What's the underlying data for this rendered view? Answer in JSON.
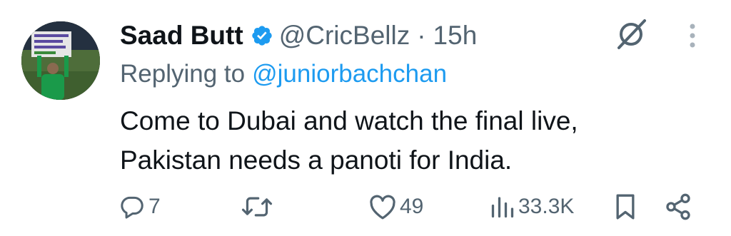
{
  "tweet": {
    "author_name": "Saad Butt",
    "handle": "@CricBellz",
    "separator": "·",
    "time": "15h",
    "replying_prefix": "Replying to",
    "replying_to": "@juniorbachchan",
    "text_line1": "Come to Dubai and watch the final live,",
    "text_line2": "Pakistan needs a panoti for India."
  },
  "metrics": {
    "replies": "7",
    "retweets": "",
    "likes": "49",
    "views": "33.3K"
  },
  "icons": {
    "verified": "verified-badge-icon",
    "grok": "grok-icon",
    "more": "more-vertical-icon",
    "reply": "reply-icon",
    "retweet": "retweet-icon",
    "like": "heart-icon",
    "views": "views-icon",
    "bookmark": "bookmark-icon",
    "share": "share-icon"
  },
  "colors": {
    "text_primary": "#0f1419",
    "text_secondary": "#536471",
    "link": "#1d9bf0",
    "verified": "#1d9bf0"
  }
}
